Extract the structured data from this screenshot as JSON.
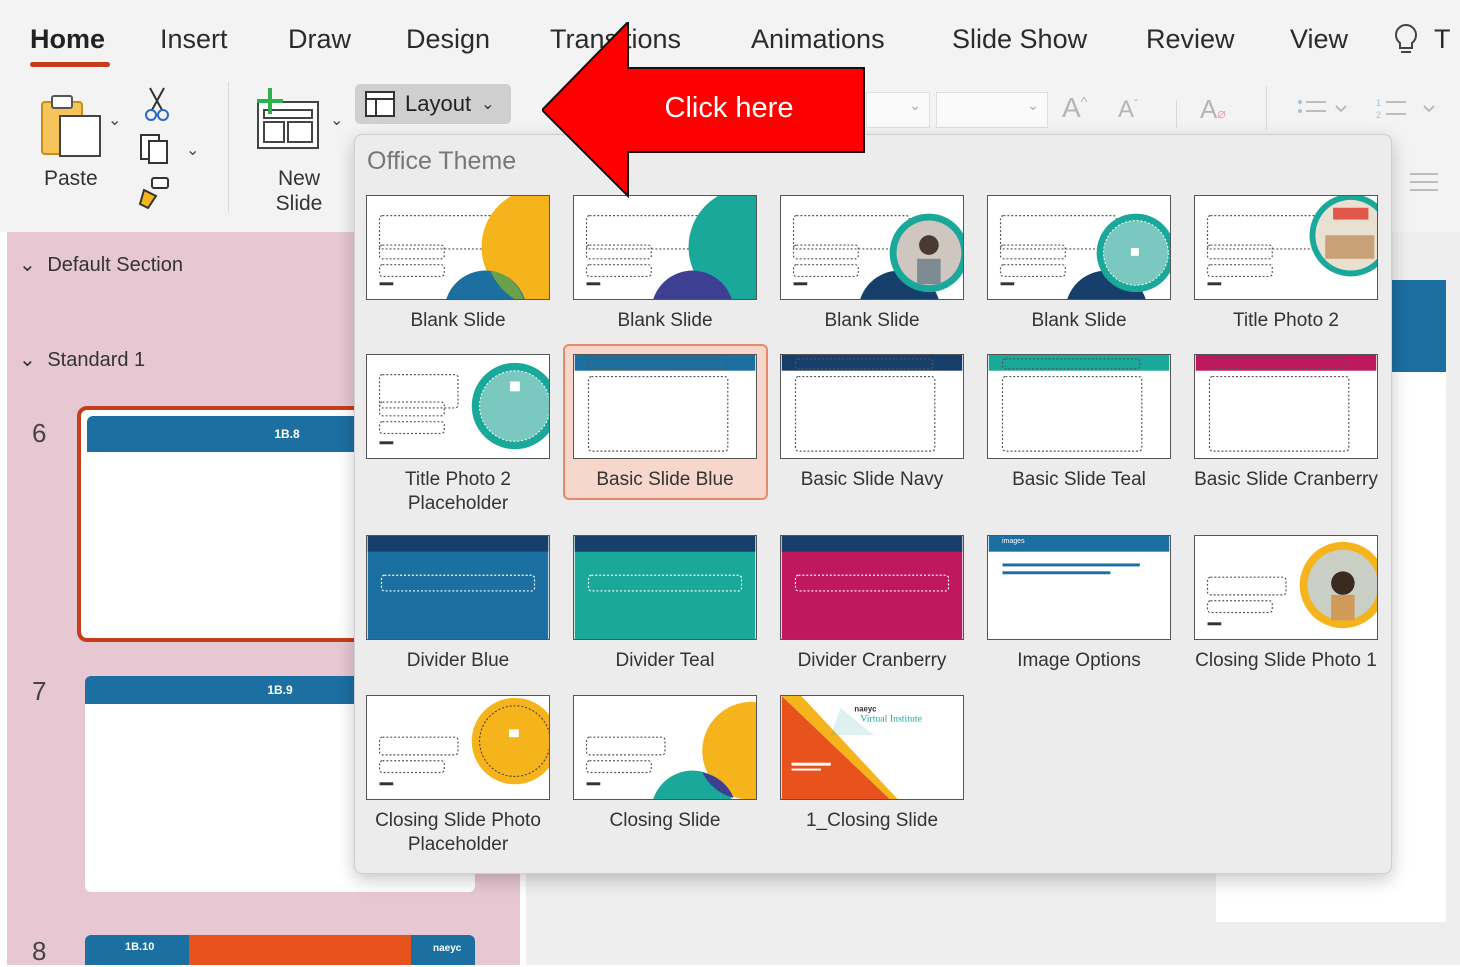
{
  "ribbon": {
    "tabs": [
      "Home",
      "Insert",
      "Draw",
      "Design",
      "Transitions",
      "Animations",
      "Slide Show",
      "Review",
      "View"
    ],
    "active_tab": "Home",
    "tell_me_partial": "T",
    "paste_label": "Paste",
    "new_slide_label": "New\nSlide",
    "layout_label": "Layout"
  },
  "callout": {
    "text": "Click here",
    "color": "#ff0000"
  },
  "sidebar": {
    "sections": [
      "Default Section",
      "Standard 1"
    ],
    "slides": [
      {
        "number": "6",
        "tag": "1B.8",
        "selected": true
      },
      {
        "number": "7",
        "tag": "1B.9",
        "selected": false
      },
      {
        "number": "8",
        "tag": "1B.10",
        "selected": false
      }
    ],
    "thumb8_brand": "naeyc"
  },
  "layout_gallery": {
    "title": "Office Theme",
    "selected": "Basic Slide Blue",
    "items": [
      {
        "name": "Blank Slide",
        "style": "blank-gold"
      },
      {
        "name": "Blank Slide",
        "style": "blank-teal"
      },
      {
        "name": "Blank Slide",
        "style": "blank-photo"
      },
      {
        "name": "Blank Slide",
        "style": "blank-navy"
      },
      {
        "name": "Title Photo 2",
        "style": "title-photo"
      },
      {
        "name": "Title Photo 2 Placeholder",
        "style": "title-photo-ph"
      },
      {
        "name": "Basic Slide Blue",
        "style": "basic",
        "color": "#1b6fa1"
      },
      {
        "name": "Basic Slide Navy",
        "style": "basic",
        "color": "#173f6b"
      },
      {
        "name": "Basic Slide Teal",
        "style": "basic",
        "color": "#1aa89a"
      },
      {
        "name": "Basic Slide Cranberry",
        "style": "basic",
        "color": "#c0185e"
      },
      {
        "name": "Divider Blue",
        "style": "divider",
        "color": "#1b6fa1"
      },
      {
        "name": "Divider Teal",
        "style": "divider",
        "color": "#1aa89a"
      },
      {
        "name": "Divider Cranberry",
        "style": "divider",
        "color": "#c0185e"
      },
      {
        "name": "Image Options",
        "style": "image-options"
      },
      {
        "name": "Closing Slide Photo 1",
        "style": "closing-photo"
      },
      {
        "name": "Closing Slide Photo Placeholder",
        "style": "closing-ph"
      },
      {
        "name": "Closing Slide",
        "style": "closing"
      },
      {
        "name": "1_Closing Slide",
        "style": "closing-vi",
        "brand": "naeyc",
        "brand_line": "Virtual Institute"
      }
    ],
    "image_options_header": "images"
  },
  "colors": {
    "accent": "#c43e1c",
    "blue": "#1b6fa1",
    "gold": "#f5b41c",
    "navy": "#173f6b",
    "teal": "#1aa89a",
    "cranberry": "#c0185e"
  }
}
